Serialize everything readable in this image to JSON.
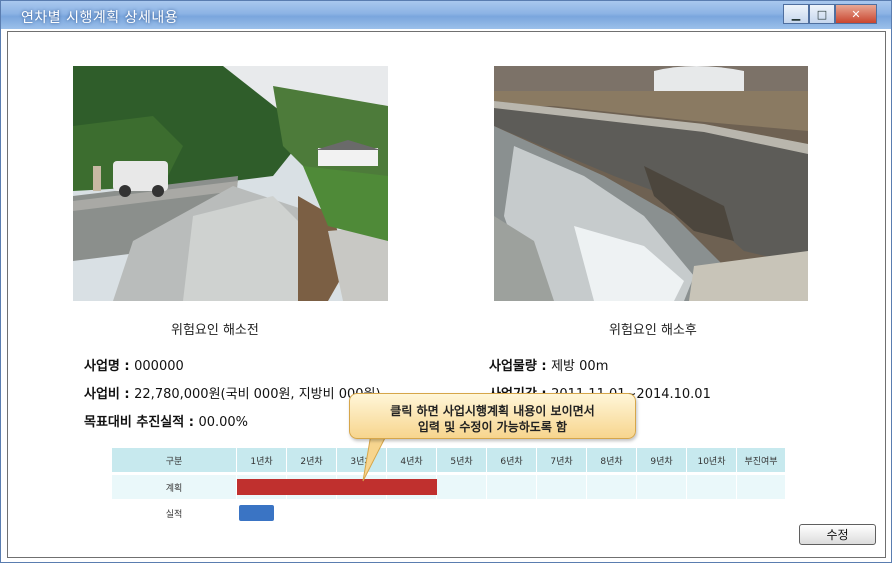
{
  "window": {
    "title": "연차별 시행계획 상세내용",
    "min": "▁",
    "max": "□",
    "close": "✕"
  },
  "photos": {
    "before_caption": "위험요인 해소전",
    "after_caption": "위험요인 해소후"
  },
  "info": {
    "name_label": "사업명 : ",
    "name_value": "000000",
    "volume_label": "사업물량 : ",
    "volume_value": "제방 00m",
    "cost_label": "사업비 : ",
    "cost_value": "22,780,000원(국비 000원, 지방비 000원)",
    "period_label": "사업기간 : ",
    "period_value": "2011.11.01~2014.10.01",
    "progress_label": "목표대비 추진실적 : ",
    "progress_value": "00.00%"
  },
  "tooltip": {
    "line1": "클릭 하면 사업시행계획 내용이 보이면서",
    "line2": "입력 및 수정이 가능하도록 함"
  },
  "table": {
    "headers": [
      "구분",
      "1년차",
      "2년차",
      "3년차",
      "4년차",
      "5년차",
      "6년차",
      "7년차",
      "8년차",
      "9년차",
      "10년차",
      "부진여부"
    ],
    "row_plan_label": "계획",
    "row_actual_label": "실적",
    "plan_span_years": [
      1,
      4
    ],
    "actual_span_years": [
      1,
      1.7
    ],
    "plan_color": "#c0302e",
    "actual_color": "#3a74c4"
  },
  "buttons": {
    "edit": "수정"
  }
}
